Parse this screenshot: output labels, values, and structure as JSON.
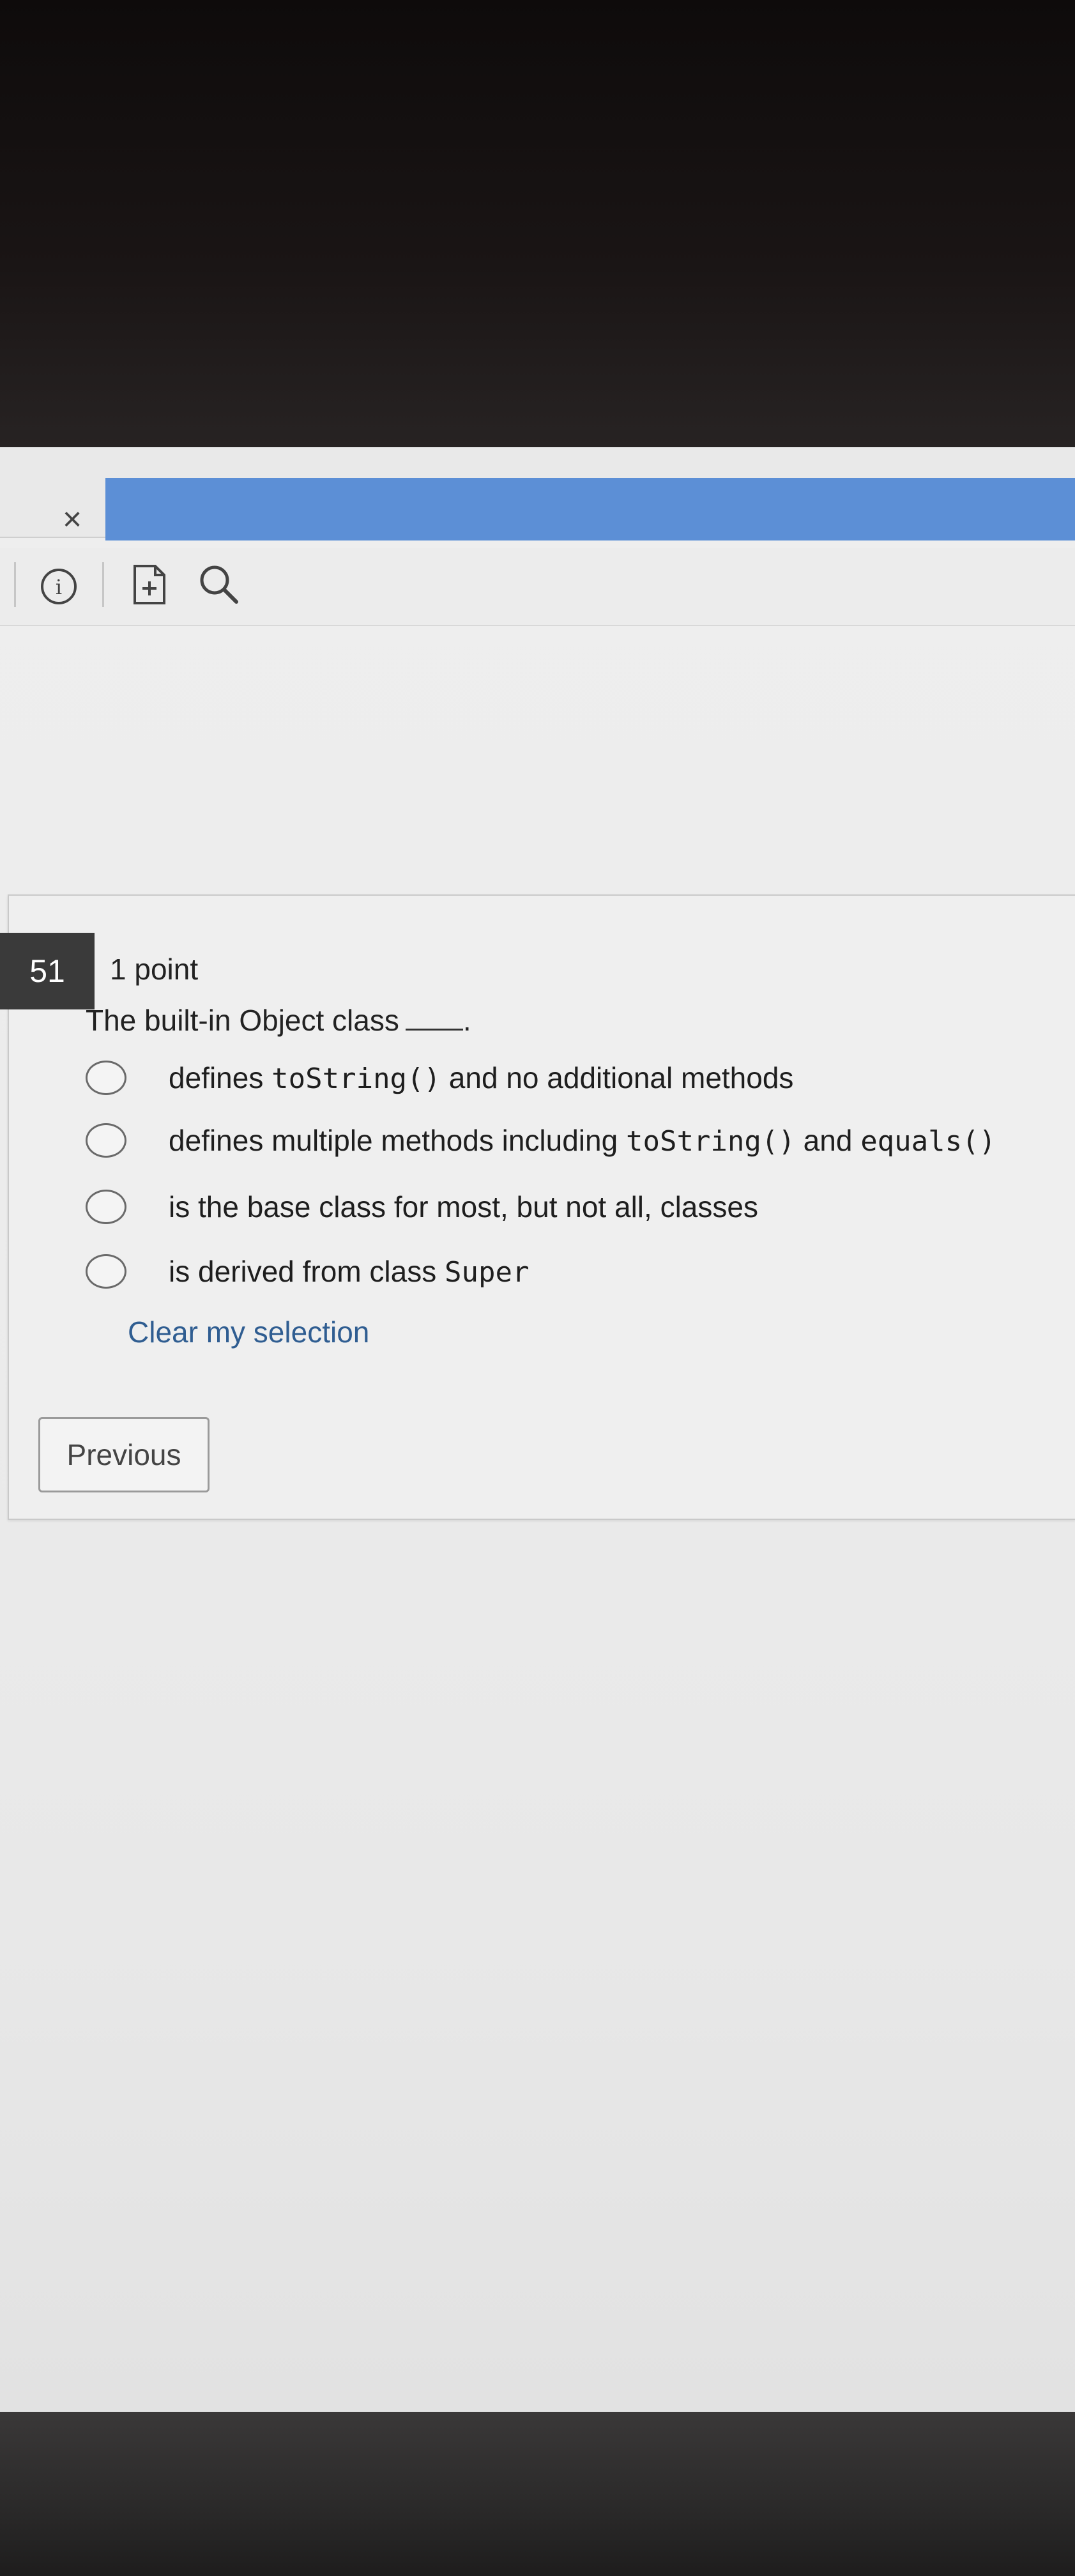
{
  "window": {
    "close_glyph": "×"
  },
  "toolbar": {
    "icons": [
      "info-icon",
      "add-page-icon",
      "search-icon"
    ],
    "info_glyph": "i"
  },
  "question": {
    "number": "51",
    "points": "1 point",
    "text": "The built-in Object class",
    "text_end": ".",
    "options": [
      {
        "before": "defines ",
        "code1": "toString()",
        "after": " and no additional methods",
        "code2": "",
        "after2": ""
      },
      {
        "before": "defines multiple methods including ",
        "code1": "toString()",
        "after": " and ",
        "code2": "equals()",
        "after2": ""
      },
      {
        "before": "is the base class for most, but not all, classes",
        "code1": "",
        "after": "",
        "code2": "",
        "after2": ""
      },
      {
        "before": "is derived from class ",
        "code1": "Super",
        "after": "",
        "code2": "",
        "after2": ""
      }
    ],
    "clear_label": "Clear my selection"
  },
  "navigation": {
    "previous_label": "Previous"
  },
  "colors": {
    "tab_accent": "#5c8fd6",
    "link": "#2f5d91",
    "badge": "#3a3a3a"
  }
}
